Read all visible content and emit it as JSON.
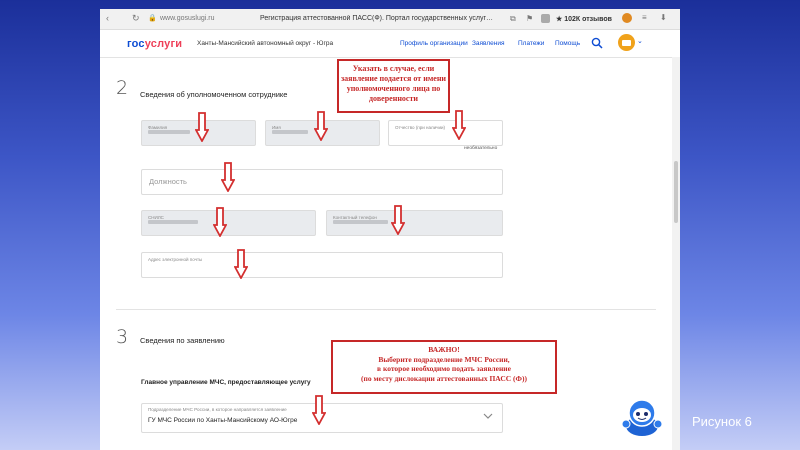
{
  "browser": {
    "url": "www.gosuslugi.ru",
    "tab_title": "Регистрация аттестованной ПАСС(Ф). Портал государственных услуг…",
    "reviews": "★ 102К отзывов"
  },
  "header": {
    "logo_part1": "гос",
    "logo_part2": "услуги",
    "region": "Ханты-Мансийский автономный округ - Югра",
    "nav": [
      "Профиль организации",
      "Заявления",
      "Платежи",
      "Помощь"
    ]
  },
  "section2": {
    "number": "2",
    "title": "Сведения об уполномоченном сотруднике",
    "fields": {
      "last_name": "Фамилия",
      "first_name": "Имя",
      "patronymic": "Отчество (при наличии)",
      "optional_note": "необязательно",
      "position": "Должность",
      "snils": "СНИЛС",
      "phone": "Контактный телефон",
      "email": "Адрес электронной почты"
    },
    "annotation": "Указать в случае, если заявление подается от имени уполномоченного лица по доверенности"
  },
  "section3": {
    "number": "3",
    "title": "Сведения по заявлению",
    "subtitle": "Главное управление МЧС, предоставляющее услугу",
    "select_label": "Подразделение МЧС России, в которое направляется заявление",
    "select_value": "ГУ МЧС России по Ханты-Мансийскому АО-Югре",
    "annotation": {
      "heading": "ВАЖНО!",
      "lines": [
        "Выберите подразделение МЧС России,",
        "в которое необходимо подать заявление",
        "(по месту дислокации аттестованных ПАСС (Ф))"
      ]
    }
  },
  "figure_label": "Рисунок 6",
  "colors": {
    "brand_blue": "#0d4cd3",
    "brand_red": "#ee3f58",
    "annotation_red": "#c62828"
  }
}
